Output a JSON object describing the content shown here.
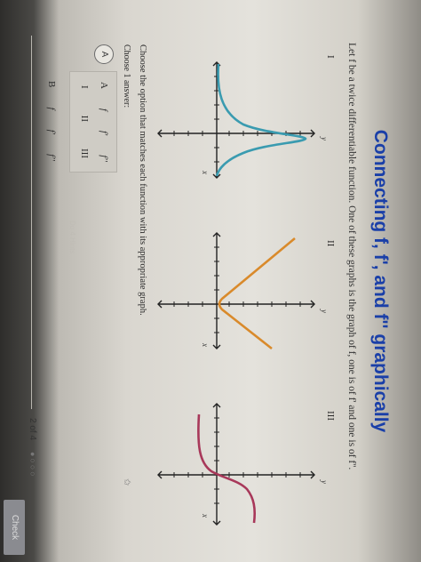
{
  "title": "Connecting f, f', and f'' graphically",
  "prompt": "Let f be a twice differentiable function. One of these graphs is the graph of f, one is of f' and one is of f''.",
  "graphs": [
    {
      "label": "I",
      "y_label": "y",
      "x_label": "x",
      "curve_color": "#3a9bb0"
    },
    {
      "label": "II",
      "y_label": "y",
      "x_label": "x",
      "curve_color": "#d98a2b"
    },
    {
      "label": "III",
      "y_label": "y",
      "x_label": "x",
      "curve_color": "#a8385a"
    }
  ],
  "question": "Choose the option that matches each function with its appropriate graph.",
  "choose_label": "Choose 1 answer:",
  "options": [
    {
      "letter": "A",
      "header": [
        "f",
        "f'",
        "f''"
      ],
      "values": [
        "I",
        "II",
        "III"
      ]
    },
    {
      "letter": "B",
      "header": [
        "f",
        "f'",
        "f''"
      ]
    }
  ],
  "progress": "2 of 4",
  "progress_dots": "●○○○",
  "check_label": "Check",
  "watermark": "Do 4 Hints",
  "star_icon": "✩"
}
